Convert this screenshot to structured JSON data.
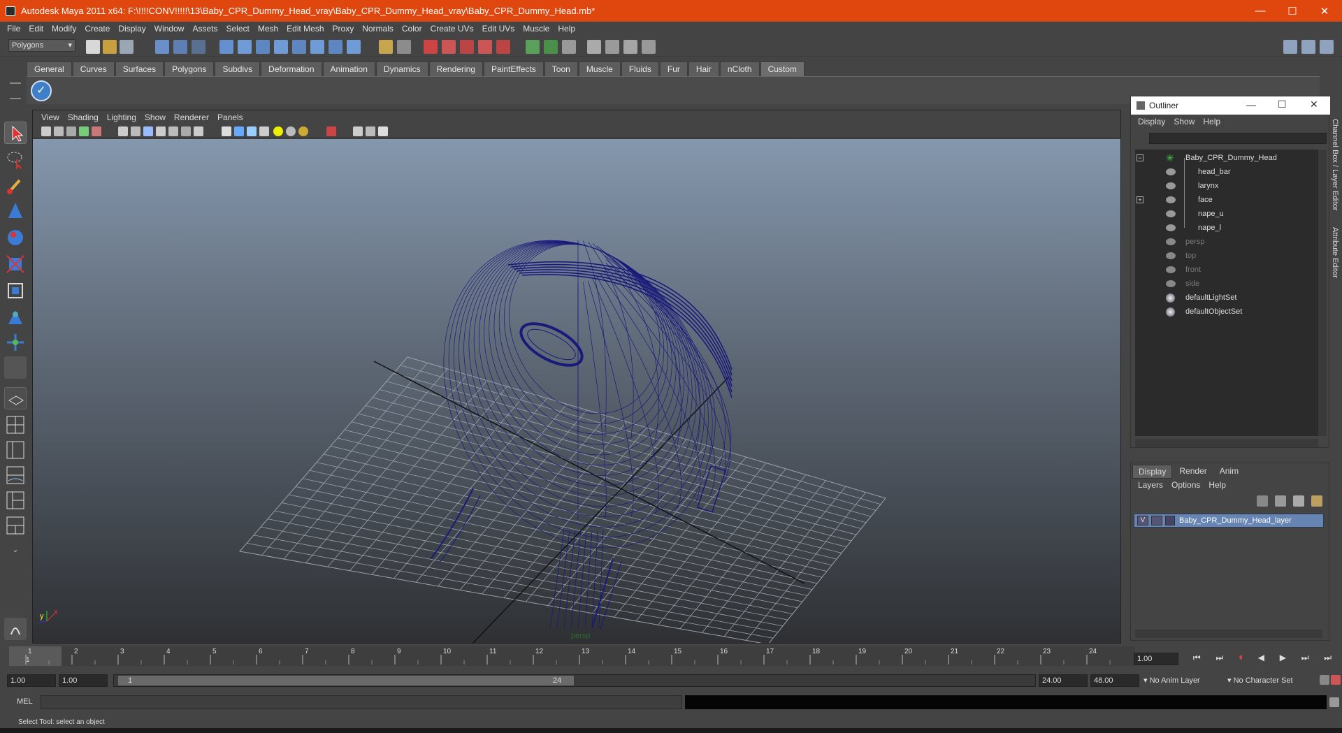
{
  "window": {
    "title": "Autodesk Maya 2011 x64: F:\\!!!!CONV!!!!!\\13\\Baby_CPR_Dummy_Head_vray\\Baby_CPR_Dummy_Head_vray\\Baby_CPR_Dummy_Head.mb*",
    "minimize": "—",
    "maximize": "☐",
    "close": "✕"
  },
  "menubar": [
    "File",
    "Edit",
    "Modify",
    "Create",
    "Display",
    "Window",
    "Assets",
    "Select",
    "Mesh",
    "Edit Mesh",
    "Proxy",
    "Normals",
    "Color",
    "Create UVs",
    "Edit UVs",
    "Muscle",
    "Help"
  ],
  "toolbar": {
    "mode": "Polygons"
  },
  "shelf": {
    "tabs": [
      "General",
      "Curves",
      "Surfaces",
      "Polygons",
      "Subdivs",
      "Deformation",
      "Animation",
      "Dynamics",
      "Rendering",
      "PaintEffects",
      "Toon",
      "Muscle",
      "Fluids",
      "Fur",
      "Hair",
      "nCloth",
      "Custom"
    ],
    "active": "Custom"
  },
  "viewport": {
    "menu": [
      "View",
      "Shading",
      "Lighting",
      "Show",
      "Renderer",
      "Panels"
    ],
    "camera_label": "persp",
    "axis_x": "x",
    "axis_y": "y",
    "wire_color": "#1a1a7a"
  },
  "outliner": {
    "title": "Outliner",
    "menu": [
      "Display",
      "Show",
      "Help"
    ],
    "items": [
      {
        "label": "Baby_CPR_Dummy_Head",
        "level": 0,
        "dim": false
      },
      {
        "label": "head_bar",
        "level": 1,
        "dim": false
      },
      {
        "label": "larynx",
        "level": 1,
        "dim": false
      },
      {
        "label": "face",
        "level": 1,
        "dim": false
      },
      {
        "label": "nape_u",
        "level": 1,
        "dim": false
      },
      {
        "label": "nape_l",
        "level": 1,
        "dim": false
      },
      {
        "label": "persp",
        "level": 0,
        "dim": true
      },
      {
        "label": "top",
        "level": 0,
        "dim": true
      },
      {
        "label": "front",
        "level": 0,
        "dim": true
      },
      {
        "label": "side",
        "level": 0,
        "dim": true
      },
      {
        "label": "defaultLightSet",
        "level": 0,
        "dim": false
      },
      {
        "label": "defaultObjectSet",
        "level": 0,
        "dim": false
      }
    ]
  },
  "side_tabs": {
    "channel_box": "Channel Box / Layer Editor",
    "attribute_editor": "Attribute Editor"
  },
  "layers": {
    "tabs": [
      "Display",
      "Render",
      "Anim"
    ],
    "menu": [
      "Layers",
      "Options",
      "Help"
    ],
    "layer_name": "Baby_CPR_Dummy_Head_layer",
    "visible_flag": "V"
  },
  "timeline": {
    "ticks": [
      "1",
      "2",
      "3",
      "4",
      "5",
      "6",
      "7",
      "8",
      "9",
      "10",
      "11",
      "12",
      "13",
      "14",
      "15",
      "16",
      "17",
      "18",
      "19",
      "20",
      "21",
      "22",
      "23",
      "24"
    ],
    "current_frame_marker": "1",
    "current_frame": "1.00"
  },
  "range": {
    "start": "1.00",
    "playback_start": "1.00",
    "slider_start": "1",
    "slider_end": "24",
    "playback_end": "24.00",
    "end": "48.00",
    "anim_layer": "No Anim Layer",
    "character_set": "No Character Set"
  },
  "command": {
    "label": "MEL"
  },
  "help_text": "Select Tool: select an object"
}
